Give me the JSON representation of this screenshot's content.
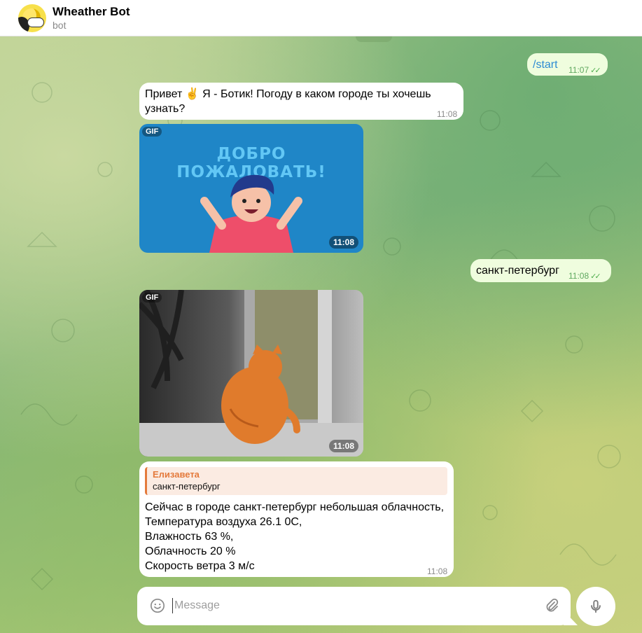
{
  "header": {
    "title": "Wheather Bot",
    "subtitle": "bot",
    "avatar_icon": "weather-bot-avatar"
  },
  "messages": {
    "m1": {
      "text": "/start",
      "time": "11:07",
      "status": "read"
    },
    "m2": {
      "text": "Привет ✌️ Я - Ботик! Погоду в каком городе ты хочешь узнать?",
      "time": "11:08"
    },
    "m3": {
      "badge": "GIF",
      "caption": "ДОБРО ПОЖАЛОВАТЬ!",
      "time": "11:08"
    },
    "m4": {
      "text": "санкт-петербург",
      "time": "11:08",
      "status": "read"
    },
    "m5": {
      "badge": "GIF",
      "time": "11:08"
    },
    "m6": {
      "reply_name": "Елизавета",
      "reply_text": "санкт-петербург",
      "lines": [
        "Сейчас в городе санкт-петербург небольшая облачность,",
        "Температура воздуха 26.1 0С,",
        "Влажность 63 %,",
        "Облачность 20 %",
        "Скорость ветра 3 м/с"
      ],
      "time": "11:08"
    }
  },
  "composer": {
    "placeholder": "Message",
    "value": ""
  },
  "colors": {
    "accent": "#2c8bd3",
    "outgoing": "#effdde",
    "incoming": "#ffffff",
    "reply_accent": "#e47a3c"
  }
}
